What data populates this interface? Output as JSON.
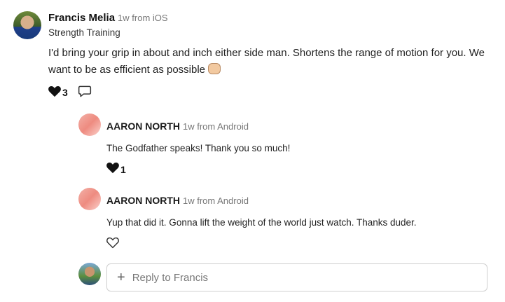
{
  "post": {
    "author": "Francis Melia",
    "meta": "1w from iOS",
    "community": "Strength Training",
    "body": "I'd bring your grip in about and inch either side man. Shortens the range of motion for you. We want to be as efficient as possible",
    "emoji_icon": "fist-bump-icon",
    "like_count": "3"
  },
  "replies": [
    {
      "author": "AARON NORTH",
      "meta": "1w from Android",
      "text": "The Godfather speaks! Thank you so much!",
      "like_count": "1",
      "liked": true
    },
    {
      "author": "AARON NORTH",
      "meta": "1w from Android",
      "text": "Yup that did it. Gonna lift the weight of the world just watch. Thanks duder.",
      "liked": false
    }
  ],
  "composer": {
    "placeholder": "Reply to Francis",
    "plus_glyph": "+"
  },
  "colors": {
    "heart_filled": "#111111",
    "text": "#222222",
    "meta": "#777777",
    "border": "#cfcfcf"
  }
}
